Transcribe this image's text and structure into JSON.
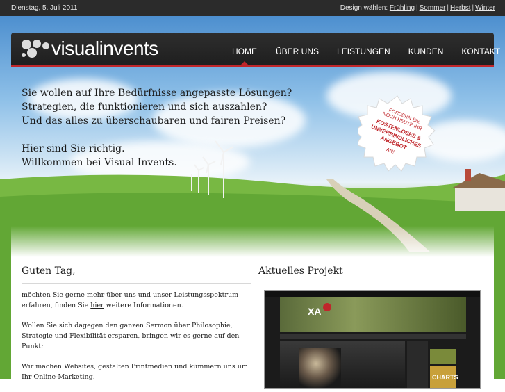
{
  "topbar": {
    "date": "Dienstag, 5. Juli 2011",
    "design_label": "Design wählen:",
    "designs": [
      "Frühling",
      "Sommer",
      "Herbst",
      "Winter"
    ]
  },
  "logo": {
    "text": "visualinvents"
  },
  "menu": {
    "items": [
      {
        "label": "HOME",
        "active": true
      },
      {
        "label": "ÜBER UNS"
      },
      {
        "label": "LEISTUNGEN"
      },
      {
        "label": "KUNDEN"
      },
      {
        "label": "KONTAKT"
      }
    ]
  },
  "slogan": {
    "line1": "Sie wollen auf Ihre Bedürfnisse angepasste Lösungen?",
    "line2": "Strategien, die funktionieren und sich auszahlen?",
    "line3": "Und das alles zu überschaubaren und fairen Preisen?",
    "line4": "Hier sind Sie richtig.",
    "line5": "Willkommen bei Visual Invents."
  },
  "badge": {
    "line1": "FORDERN SIE",
    "line2": "NOCH HEUTE IHR",
    "line3": "KOSTENLOSES &",
    "line4": "UNVERBINDLICHES",
    "line5": "ANGEBOT",
    "line6": "AN!"
  },
  "left": {
    "heading": "Guten Tag,",
    "p1_before": "möchten Sie gerne mehr über uns und unser Leistungsspektrum erfahren, finden Sie ",
    "p1_link": "hier",
    "p1_after": " weitere Informationen.",
    "p2": "Wollen Sie sich dagegen den ganzen Sermon über Philosophie, Strategie und Flexibilität ersparen, bringen wir es gerne auf den Punkt:",
    "p3": "Wir machen Websites, gestalten Printmedien und kümmern uns um Ihr Online-Marketing."
  },
  "right": {
    "heading": "Aktuelles Projekt",
    "thumb_label": "CHARTS"
  },
  "colors": {
    "accent": "#c0262b",
    "nav_bg": "#2b2b2b"
  }
}
